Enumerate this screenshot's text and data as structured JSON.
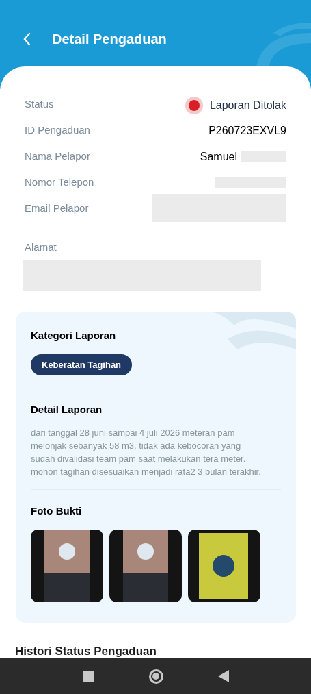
{
  "header": {
    "title": "Detail Pengaduan"
  },
  "details": [
    {
      "label": "Status",
      "value": "Laporan Ditolak",
      "kind": "status"
    },
    {
      "label": "ID Pengaduan",
      "value": "P260723EXVL9",
      "kind": "text"
    },
    {
      "label": "Nama Pelapor",
      "value": "Samuel",
      "kind": "partly_hidden"
    },
    {
      "label": "Nomor Telepon",
      "kind": "hidden"
    },
    {
      "label": "Email Pelapor",
      "kind": "hidden_tall"
    },
    {
      "label": "Alamat",
      "kind": "hidden_block"
    }
  ],
  "report": {
    "category_heading": "Kategori Laporan",
    "category": "Keberatan Tagihan",
    "detail_heading": "Detail Laporan",
    "detail_text": "dari tanggal 28 juni sampai 4 juli 2026 meteran pam melonjak sebanyak 58 m3, tidak ada kebocoran yang sudah divalidasi team pam saat melakukan tera meter. mohon tagihan disesuaikan menjadi rata2 3 bulan terakhir.",
    "photos_heading": "Foto Bukti",
    "photos": [
      {
        "kind": "meter"
      },
      {
        "kind": "meter"
      },
      {
        "kind": "pipe"
      }
    ]
  },
  "history_heading": "Histori Status Pengaduan"
}
